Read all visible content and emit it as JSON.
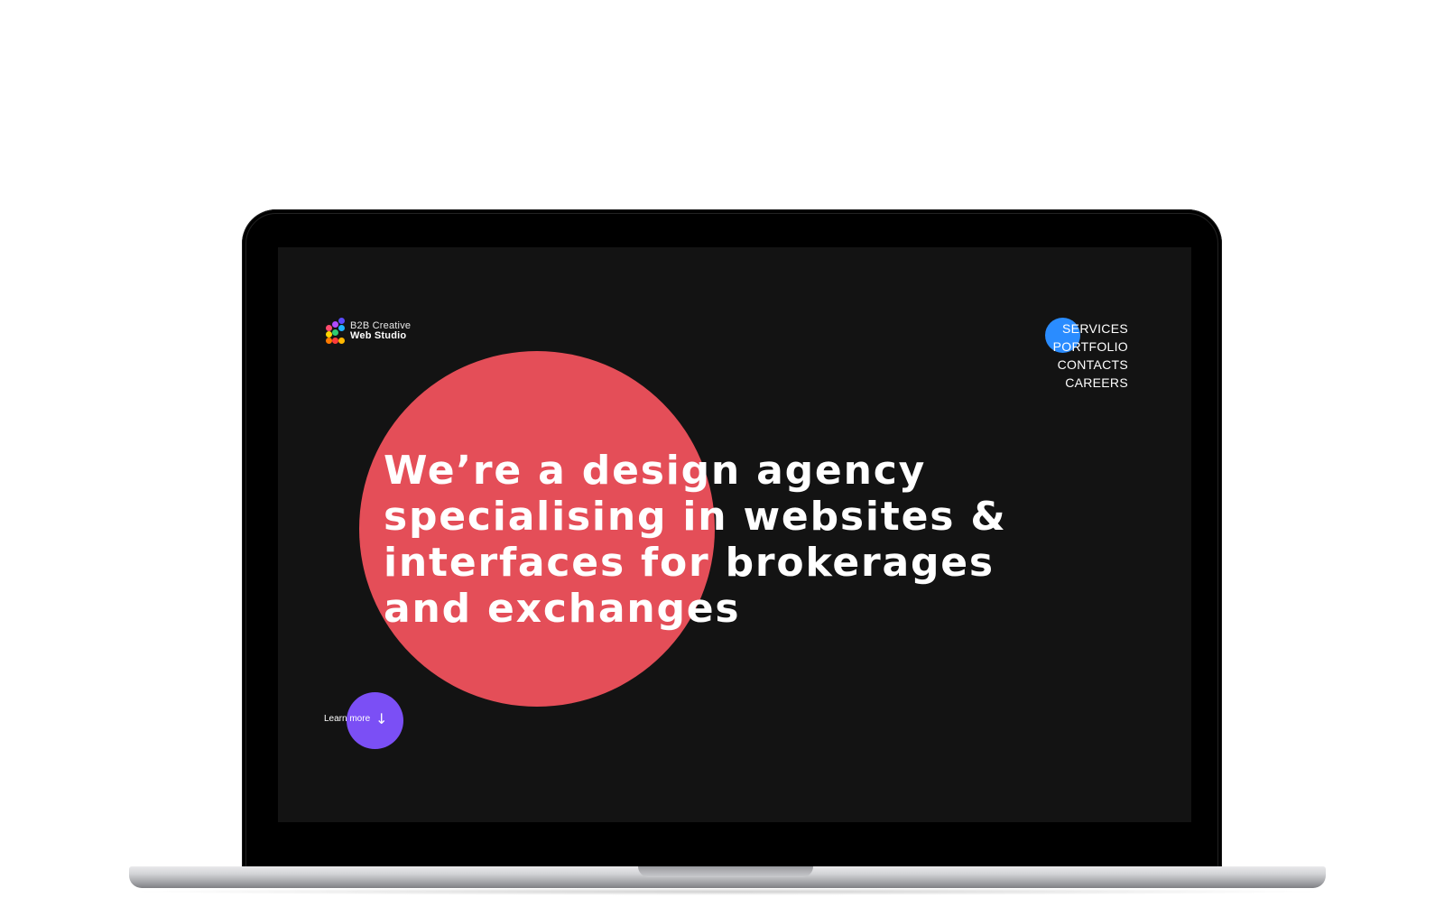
{
  "logo": {
    "line1": "B2B Creative",
    "line2": "Web Studio",
    "dot_colors": [
      "#5b4bff",
      "#b14bff",
      "#1fb3ff",
      "#ff4b6e",
      "#2ecc71",
      "#ffd400",
      "#ff7a00",
      "#ff3b3b",
      "#ffb800"
    ]
  },
  "nav": {
    "items": [
      {
        "label": "SERVICES"
      },
      {
        "label": "PORTFOLIO"
      },
      {
        "label": "CONTACTS"
      },
      {
        "label": "CAREERS"
      }
    ],
    "blob_color": "#2a8cff"
  },
  "hero": {
    "title": "We’re a design agency specialising in websites & interfaces for brokerages and exchanges",
    "circle_color": "#e44e58"
  },
  "cta": {
    "label": "Learn more",
    "icon": "arrow-down-icon",
    "arrow": "↓",
    "color": "#7b4ff5"
  },
  "colors": {
    "screen_bg": "#131313",
    "bezel": "#000000"
  }
}
